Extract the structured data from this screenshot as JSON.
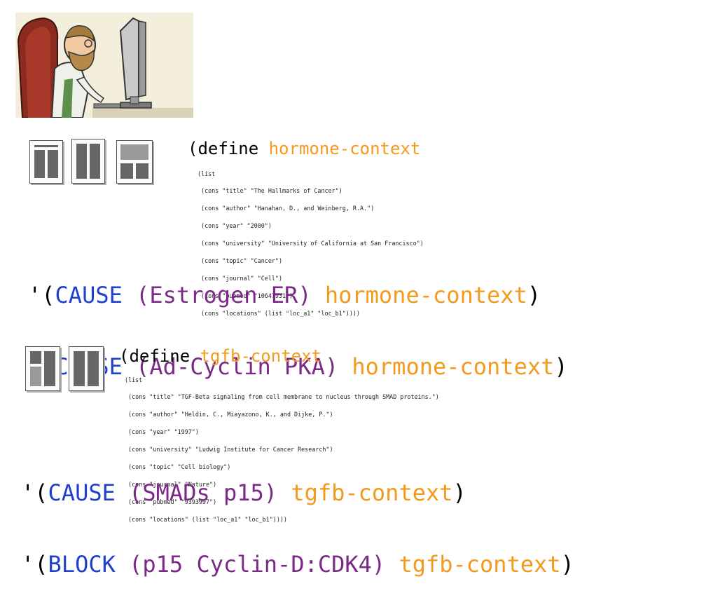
{
  "section1": {
    "define_keyword": "(define",
    "context_name": "hormone-context",
    "context_list": [
      "(list",
      " (cons \"title\" \"The Hallmarks of Cancer\")",
      " (cons \"author\" \"Hanahan, D., and Weinberg, R.A.\")",
      " (cons \"year\" \"2000\")",
      " (cons \"university\" \"University of California at San Francisco\")",
      " (cons \"topic\" \"Cancer\")",
      " (cons \"journal\" \"Cell\")",
      " (cons \"pubmed\" \"10647931\")",
      " (cons \"locations\" (list \"loc_a1\" \"loc_b1\"))))"
    ],
    "statements": [
      {
        "open": "'(",
        "verb": "CAUSE",
        "args": "(Estrogen ER)",
        "context": "hormone-context",
        "close": ")"
      },
      {
        "open": "'(",
        "verb": "CAUSE",
        "args": "(Ad-Cyclin PKA)",
        "context": "hormone-context",
        "close": ")"
      }
    ]
  },
  "section2": {
    "define_keyword": "(define",
    "context_name": "tgfb-context",
    "context_list": [
      "(list",
      " (cons \"title\" \"TGF-Beta signaling from cell membrane to nucleus through SMAD proteins.\")",
      " (cons \"author\" \"Heldin, C., Miayazono, K., and Dijke, P.\")",
      " (cons \"year\" \"1997\")",
      " (cons \"university\" \"Ludwig Institute for Cancer Research\")",
      " (cons \"topic\" \"Cell biology\")",
      " (cons \"journal\" \"Nature\")",
      " (cons \"pubmed\" \"9393997\")",
      " (cons \"locations\" (list \"loc_a1\" \"loc_b1\"))))"
    ],
    "statements": [
      {
        "open": "'(",
        "verb": "CAUSE",
        "args": "(SMADs p15)",
        "context": "tgfb-context",
        "close": ")"
      },
      {
        "open": "'(",
        "verb": "BLOCK",
        "args": "(p15 Cyclin-D:CDK4)",
        "context": "tgfb-context",
        "close": ")"
      }
    ]
  },
  "colors": {
    "keyword": "#1f3fd1",
    "entity": "#7a2a86",
    "context": "#f39a1e"
  }
}
